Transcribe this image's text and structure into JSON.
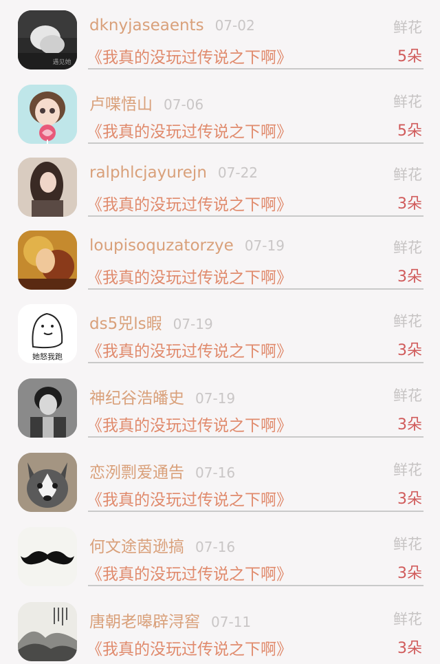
{
  "rows": [
    {
      "username": "dknyjaseaents",
      "date": "07-02",
      "label": "鲜花",
      "title": "《我真的没玩过传说之下啊》",
      "count": "5朵",
      "avatar": "dark-photo-hands-avatar",
      "avatar_caption": "遇见她"
    },
    {
      "username": "卢喋悟山",
      "date": "07-06",
      "label": "鲜花",
      "title": "《我真的没玩过传说之下啊》",
      "count": "5朵",
      "avatar": "cartoon-girl-lollipop-avatar"
    },
    {
      "username": "ralphlcjayurejn",
      "date": "07-22",
      "label": "鲜花",
      "title": "《我真的没玩过传说之下啊》",
      "count": "3朵",
      "avatar": "long-hair-girl-avatar"
    },
    {
      "username": "loupisoquzatorzye",
      "date": "07-19",
      "label": "鲜花",
      "title": "《我真的没玩过传说之下啊》",
      "count": "3朵",
      "avatar": "warm-collage-avatar"
    },
    {
      "username": "ds5兕ls暇",
      "date": "07-19",
      "label": "鲜花",
      "title": "《我真的没玩过传说之下啊》",
      "count": "3朵",
      "avatar": "doodle-ghost-avatar",
      "avatar_caption": "她怒我跑"
    },
    {
      "username": "神纪谷浩皤史",
      "date": "07-19",
      "label": "鲜花",
      "title": "《我真的没玩过传说之下啊》",
      "count": "3朵",
      "avatar": "bw-young-man-avatar"
    },
    {
      "username": "恋洌剽爱通告",
      "date": "07-16",
      "label": "鲜花",
      "title": "《我真的没玩过传说之下啊》",
      "count": "3朵",
      "avatar": "husky-dog-avatar"
    },
    {
      "username": "何文途茵逊搞",
      "date": "07-16",
      "label": "鲜花",
      "title": "《我真的没玩过传说之下啊》",
      "count": "3朵",
      "avatar": "mustache-avatar"
    },
    {
      "username": "唐朝老嗥辟浔窖",
      "date": "07-11",
      "label": "鲜花",
      "title": "《我真的没玩过传说之下啊》",
      "count": "3朵",
      "avatar": "ink-landscape-avatar"
    }
  ]
}
